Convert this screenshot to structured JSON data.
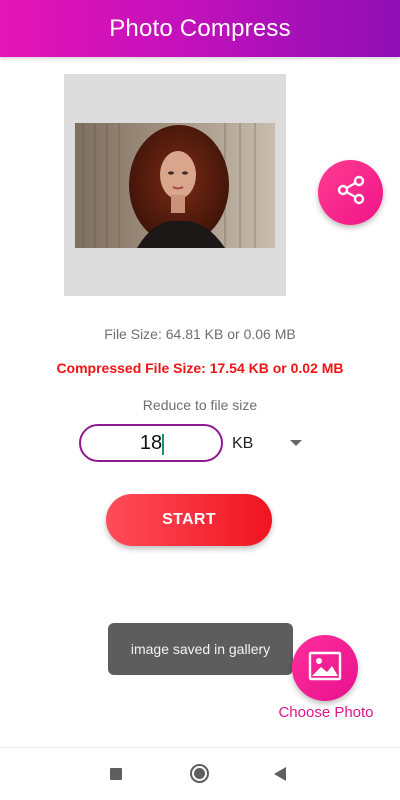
{
  "header": {
    "title": "Photo Compress"
  },
  "preview": {
    "image_icon": "portrait-photo"
  },
  "share": {
    "icon": "share-icon"
  },
  "info": {
    "file_size": "File Size: 64.81 KB or 0.06 MB",
    "compressed_size": "Compressed File Size: 17.54 KB or 0.02 MB",
    "reduce_label": "Reduce to file size"
  },
  "size_input": {
    "value": "18"
  },
  "unit_select": {
    "selected": "KB"
  },
  "start_button": {
    "label": "START"
  },
  "toast": {
    "message": "image saved in gallery"
  },
  "choose_photo": {
    "label": "Choose Photo",
    "icon": "image-icon"
  },
  "colors": {
    "header_start": "#e514b5",
    "header_end": "#8e0fb4",
    "accent_pink": "#e0168a",
    "compressed_red": "#f21313",
    "start_red": "#f0141f"
  }
}
